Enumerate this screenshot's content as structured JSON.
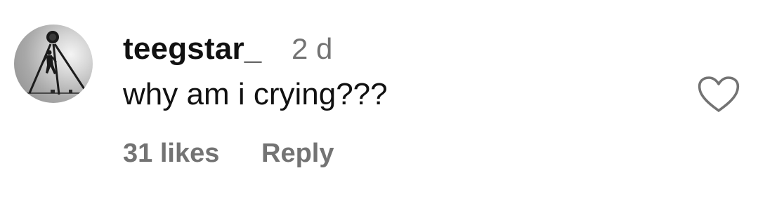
{
  "comment": {
    "username": "teegstar_",
    "timestamp": "2 d",
    "text": "why am i crying???",
    "likes_label": "31 likes",
    "reply_label": "Reply"
  },
  "icons": {
    "avatar": "profile-photo",
    "like": "heart-outline-icon"
  },
  "colors": {
    "primary_text": "#111111",
    "secondary_text": "#737373",
    "background": "#ffffff",
    "heart_stroke": "#737373"
  }
}
